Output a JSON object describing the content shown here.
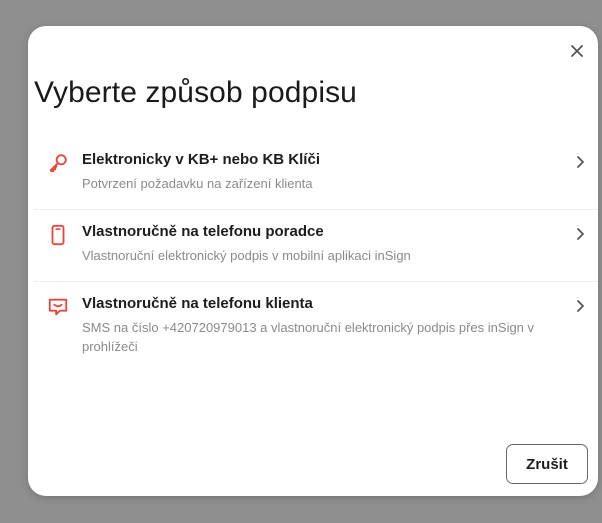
{
  "dialog": {
    "title": "Vyberte způsob podpisu",
    "close_icon": "close-icon",
    "cancel_label": "Zrušit"
  },
  "options": [
    {
      "label": "Elektronicky v KB+ nebo KB Klíči",
      "description": "Potvrzení požadavku na zařízení klienta",
      "icon": "key-icon"
    },
    {
      "label": "Vlastnoručně na telefonu poradce",
      "description": "Vlastnoruční elektronický podpis v mobilní aplikaci inSign",
      "icon": "phone-icon"
    },
    {
      "label": "Vlastnoručně na telefonu klienta",
      "description": "SMS na číslo +420720979013 a vlastnoruční elektronický podpis přes inSign v prohlížeči",
      "icon": "sms-icon"
    }
  ],
  "colors": {
    "accent": "#e5483d",
    "backdrop": "#8f8f8f",
    "surface": "#ffffff",
    "text": "#1d1d1d",
    "muted_text": "#8a8a8a"
  }
}
